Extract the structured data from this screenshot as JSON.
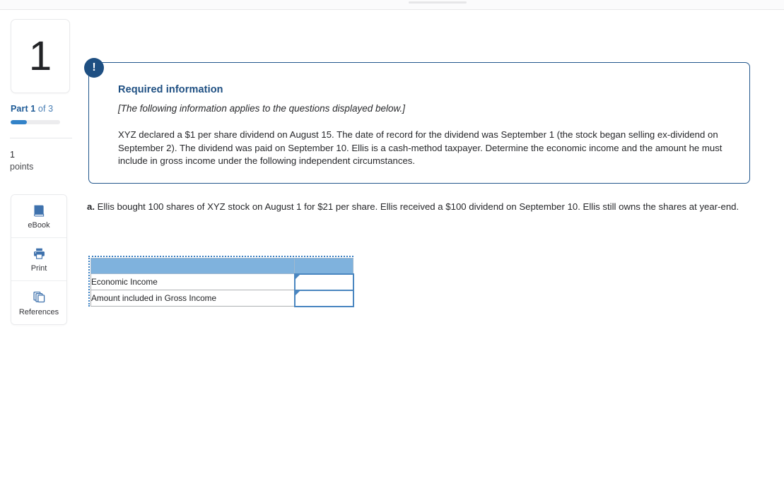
{
  "sidebar": {
    "question_number": "1",
    "part_prefix": "Part 1",
    "part_suffix": " of 3",
    "progress_percent": 33,
    "points_value": "1",
    "points_label": "points",
    "tools": [
      {
        "label": "eBook",
        "icon": "ebook-icon"
      },
      {
        "label": "Print",
        "icon": "printer-icon"
      },
      {
        "label": "References",
        "icon": "references-icon"
      }
    ]
  },
  "callout": {
    "badge_icon": "exclamation-icon",
    "badge_glyph": "!",
    "title": "Required information",
    "subtitle": "[The following information applies to the questions displayed below.]",
    "body": "XYZ declared a $1 per share dividend on August 15. The date of record for the dividend was September 1 (the stock began selling ex-dividend on September 2). The dividend was paid on September 10. Ellis is a cash-method taxpayer. Determine the economic income and the amount he must include in gross income under the following independent circumstances."
  },
  "question": {
    "marker": "a.",
    "text": " Ellis bought 100 shares of XYZ stock on August 1 for $21 per share. Ellis received a $100 dividend on September 10. Ellis still owns the shares at year-end."
  },
  "answer_table": {
    "header": {
      "label_col": "",
      "value_col": ""
    },
    "rows": [
      {
        "label": "Economic Income",
        "value": "",
        "placeholder": ""
      },
      {
        "label": "Amount included in Gross Income",
        "value": "",
        "placeholder": ""
      }
    ]
  },
  "colors": {
    "accent_navy": "#1e4f82",
    "accent_blue": "#3282c8",
    "table_header_blue": "#7fb2dd",
    "input_border_blue": "#4a86c0",
    "dotted_border_blue": "#3a7fc1"
  }
}
